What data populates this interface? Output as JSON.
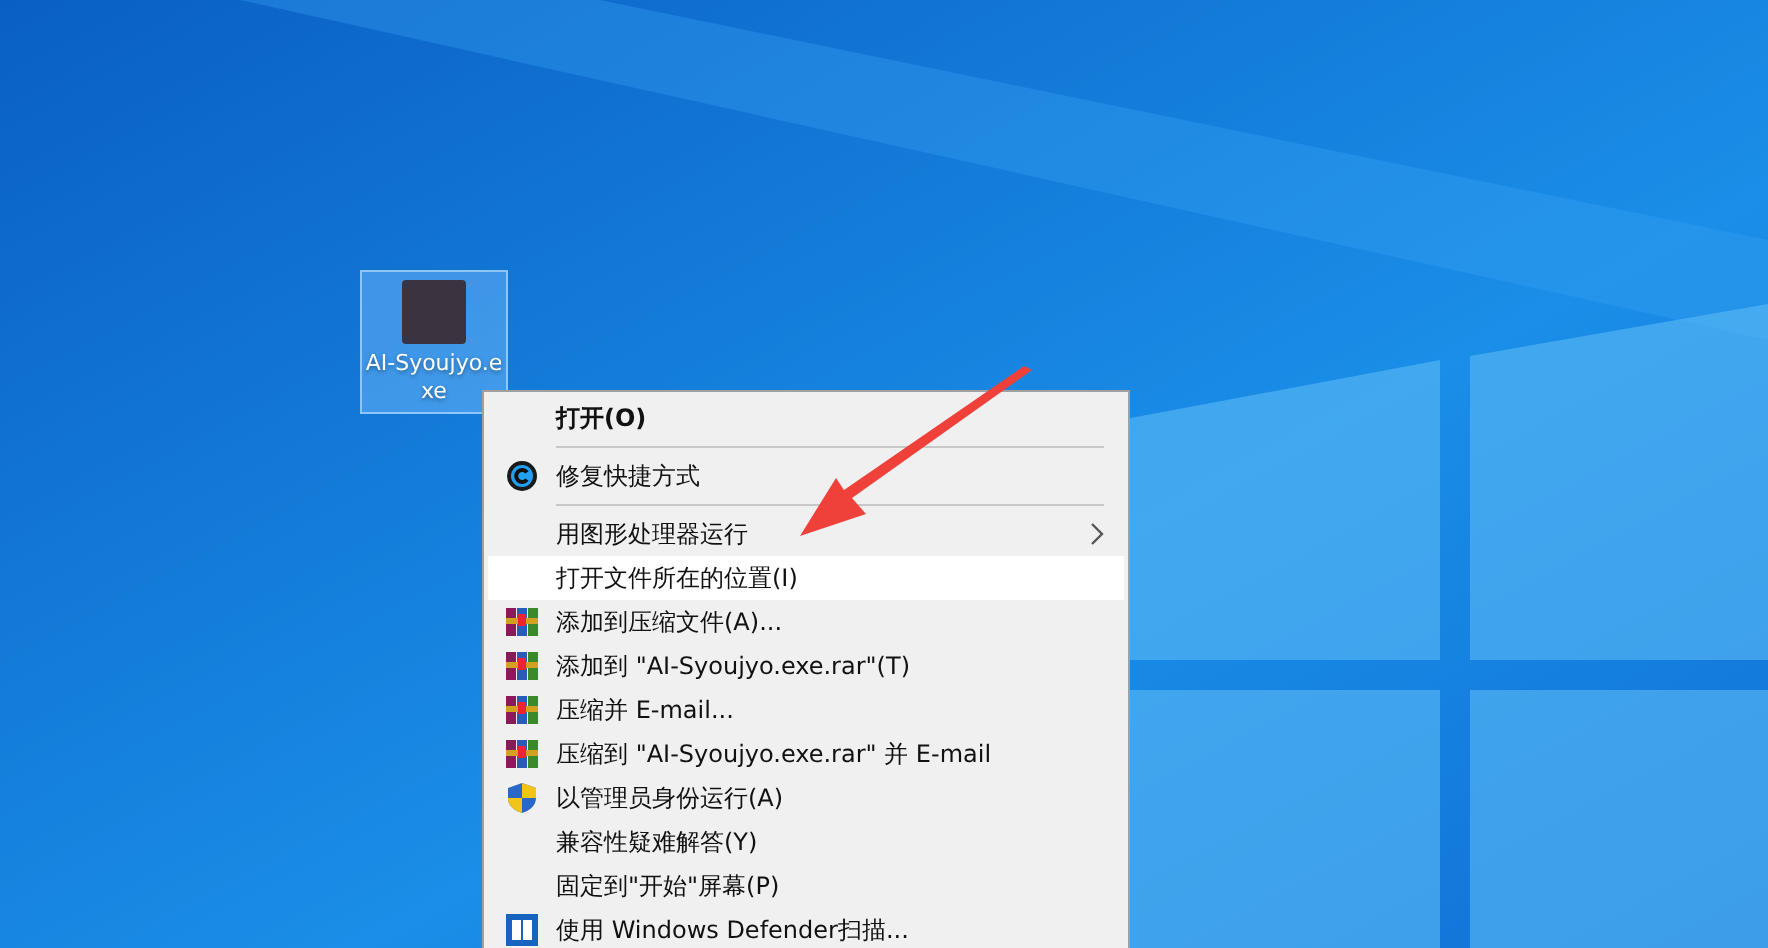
{
  "desktop_icon": {
    "label": "AI-Syoujyo.exe",
    "selected": true
  },
  "context_menu": {
    "items": [
      {
        "kind": "plain",
        "label": "打开(O)",
        "bold": true,
        "submenu": false,
        "selected": false
      },
      {
        "kind": "separator"
      },
      {
        "kind": "repair",
        "label": "修复快捷方式",
        "bold": false,
        "submenu": false,
        "selected": false
      },
      {
        "kind": "separator"
      },
      {
        "kind": "plain",
        "label": "用图形处理器运行",
        "bold": false,
        "submenu": true,
        "selected": false
      },
      {
        "kind": "plain",
        "label": "打开文件所在的位置(I)",
        "bold": false,
        "submenu": false,
        "selected": true
      },
      {
        "kind": "archive",
        "label": "添加到压缩文件(A)...",
        "bold": false,
        "submenu": false,
        "selected": false
      },
      {
        "kind": "archive",
        "label": "添加到 \"AI-Syoujyo.exe.rar\"(T)",
        "bold": false,
        "submenu": false,
        "selected": false
      },
      {
        "kind": "archive",
        "label": "压缩并 E-mail...",
        "bold": false,
        "submenu": false,
        "selected": false
      },
      {
        "kind": "archive",
        "label": "压缩到 \"AI-Syoujyo.exe.rar\" 并 E-mail",
        "bold": false,
        "submenu": false,
        "selected": false
      },
      {
        "kind": "shield",
        "label": "以管理员身份运行(A)",
        "bold": false,
        "submenu": false,
        "selected": false
      },
      {
        "kind": "plain",
        "label": "兼容性疑难解答(Y)",
        "bold": false,
        "submenu": false,
        "selected": false
      },
      {
        "kind": "plain",
        "label": "固定到\"开始\"屏幕(P)",
        "bold": false,
        "submenu": false,
        "selected": false
      },
      {
        "kind": "defender",
        "label": "使用 Windows Defender扫描...",
        "bold": false,
        "submenu": false,
        "selected": false
      }
    ]
  }
}
